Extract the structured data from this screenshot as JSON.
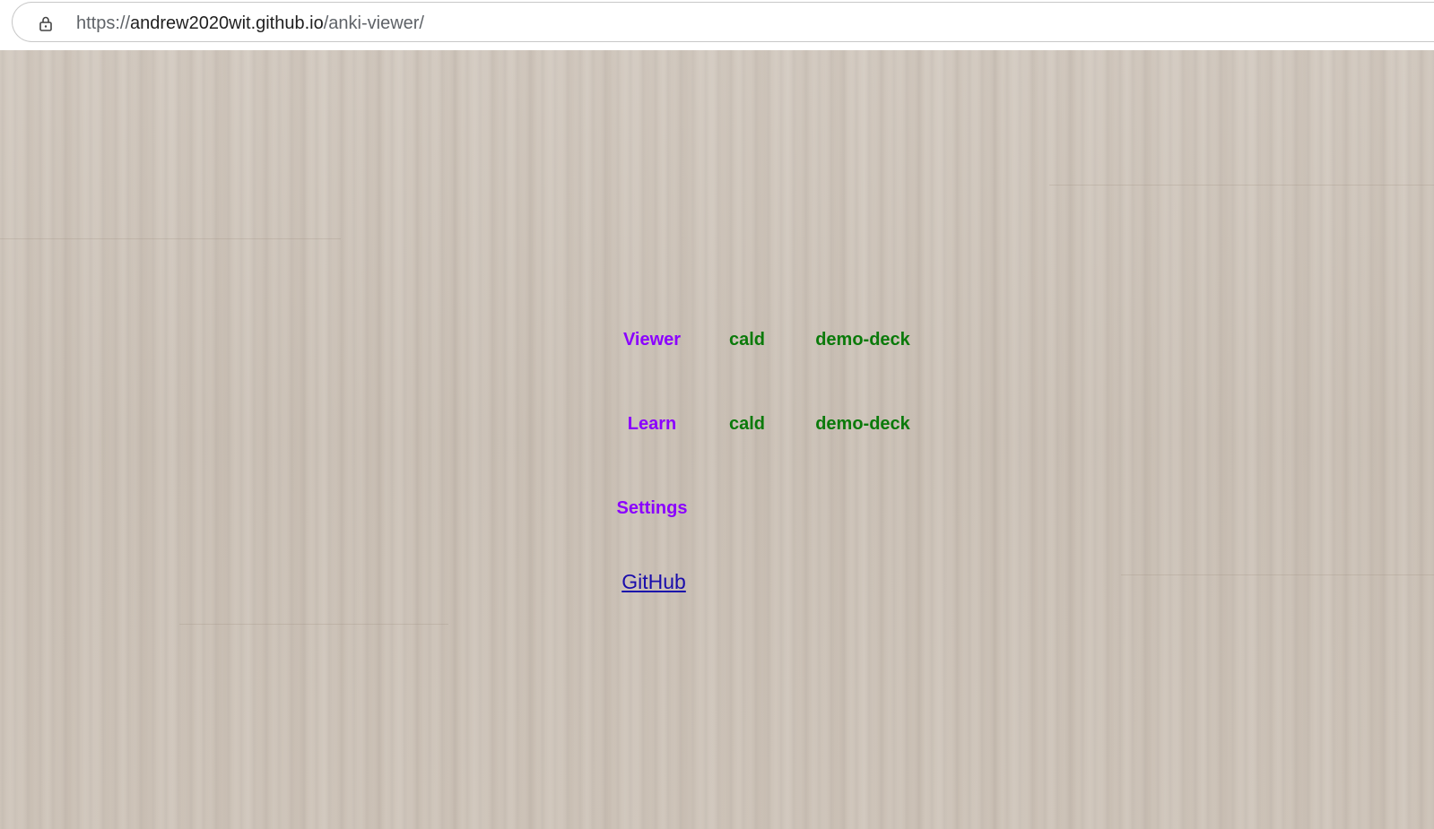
{
  "browser": {
    "url_scheme": "https://",
    "url_host": "andrew2020wit.github.io",
    "url_path": "/anki-viewer/"
  },
  "menu": {
    "viewer_label": "Viewer",
    "learn_label": "Learn",
    "settings_label": "Settings",
    "viewer_decks": [
      "cald",
      "demo-deck"
    ],
    "learn_decks": [
      "cald",
      "demo-deck"
    ],
    "github_label": "GitHub"
  },
  "colors": {
    "section_link": "#8b00ff",
    "deck_link": "#0a7a0a",
    "github_link": "#1a0dab",
    "background": "#cdc3b8"
  },
  "icons": {
    "lock": "lock-icon"
  }
}
